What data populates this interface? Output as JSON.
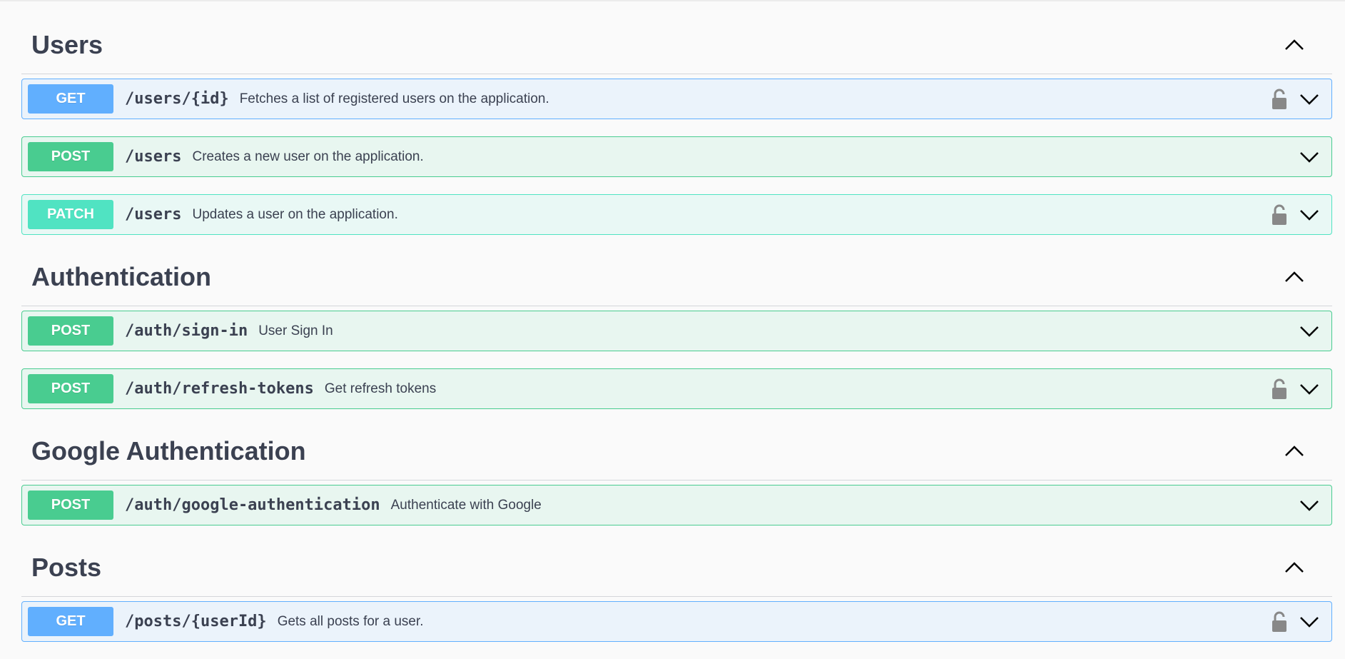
{
  "sections": [
    {
      "title": "Users",
      "operations": [
        {
          "method": "GET",
          "path": "/users/{id}",
          "summary": "Fetches a list of registered users on the application.",
          "locked": true
        },
        {
          "method": "POST",
          "path": "/users",
          "summary": "Creates a new user on the application.",
          "locked": false
        },
        {
          "method": "PATCH",
          "path": "/users",
          "summary": "Updates a user on the application.",
          "locked": true
        }
      ]
    },
    {
      "title": "Authentication",
      "operations": [
        {
          "method": "POST",
          "path": "/auth/sign-in",
          "summary": "User Sign In",
          "locked": false
        },
        {
          "method": "POST",
          "path": "/auth/refresh-tokens",
          "summary": "Get refresh tokens",
          "locked": true
        }
      ]
    },
    {
      "title": "Google Authentication",
      "operations": [
        {
          "method": "POST",
          "path": "/auth/google-authentication",
          "summary": "Authenticate with Google",
          "locked": false
        }
      ]
    },
    {
      "title": "Posts",
      "operations": [
        {
          "method": "GET",
          "path": "/posts/{userId}",
          "summary": "Gets all posts for a user.",
          "locked": true
        }
      ]
    }
  ],
  "icons": {
    "collapse": "chevron-up-icon",
    "expand": "chevron-down-icon",
    "lock": "lock-icon"
  },
  "colors": {
    "get": "#61affe",
    "post": "#49cc90",
    "patch": "#50e3c2",
    "text": "#3b4151"
  }
}
